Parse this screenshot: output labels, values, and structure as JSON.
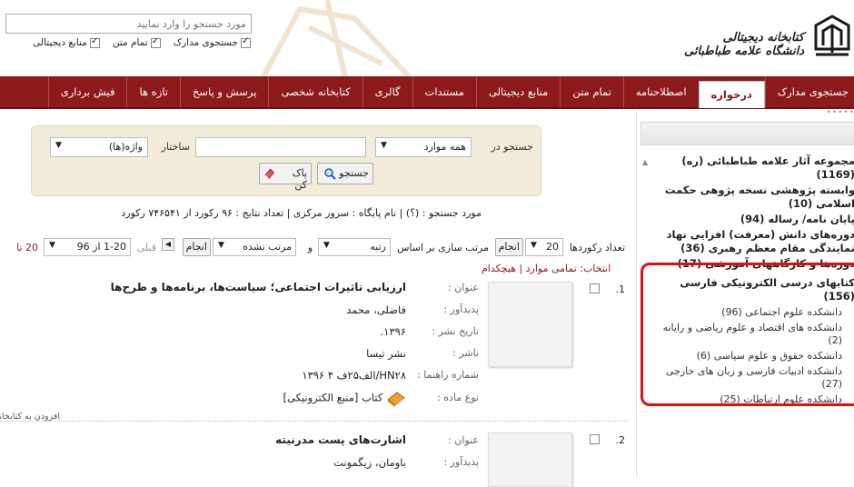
{
  "header": {
    "search_placeholder": "مورد جستجو را وارد نمایید",
    "checkboxes": [
      {
        "label": "جستجوی مدارک",
        "checked": true
      },
      {
        "label": "تمام متن",
        "checked": true
      },
      {
        "label": "منابع دیجیتالی",
        "checked": true
      }
    ],
    "logo_text": "کتابخانه دیجیتالی دانشگاه علامه طباطبائی"
  },
  "nav": {
    "items": [
      "جستجوی مدارک",
      "درخواره",
      "اصطلاحنامه",
      "تمام متن",
      "منابع دیجیتالی",
      "مستندات",
      "گالری",
      "کتابخانه شخصی",
      "پرسش و پاسخ",
      "تازه ها",
      "فیش برداری"
    ],
    "active_index": 1
  },
  "search_panel": {
    "search_in_label": "جستجو در",
    "search_in_value": "همه موارد",
    "structure_label": "ساختار",
    "structure_value": "واژه(ها)",
    "search_button": "جستجو",
    "clear_button": "پاک کن"
  },
  "query_info": "مورد جستجو : (؟) | نام پایگاه : سرور مرکزی | تعداد نتایج : ۹۶ رکورد از ۷۴۶۵۴۱ رکورد",
  "results_bar": {
    "records_count_label": "تعداد رکوردها",
    "records_count_value": "20",
    "do_button": "انجام",
    "sort_label": "مرتب سازی بر اساس",
    "sort_field": "رتبه",
    "and_label": "و",
    "sort_order": "مرتب نشده",
    "prev_label": "قبلی",
    "page_range": "1-20 از 96",
    "next_text": "20 تا"
  },
  "select_row": "انتخاب: تمامی موارد | هیچکدام",
  "records": [
    {
      "number": "1.",
      "fields": [
        {
          "label": "عنوان :",
          "value": "ارزیابی تاثیرات اجتماعی؛ سیاست‌ها، برنامه‌ها و طرح‌ها"
        },
        {
          "label": "پدیدآور :",
          "value": "فاضلی، محمد"
        },
        {
          "label": "تاریخ نشر :",
          "value": "۱۳۹۶."
        },
        {
          "label": "ناشر :",
          "value": "نشر تیسا"
        },
        {
          "label": "شماره راهنما :",
          "value": "HN۲۸/الف۲۵ف ۴ ۱۳۹۶"
        },
        {
          "label": "نوع ماده :",
          "value": "کتاب [منبع الکترونیکی]"
        }
      ],
      "add_to_cart": "افزودن به کتابخانه شخصی"
    },
    {
      "number": "2.",
      "fields": [
        {
          "label": "عنوان :",
          "value": "اشارت‌های پست مدرنیته"
        },
        {
          "label": "پدیدآور :",
          "value": "باومان، زیگمونت"
        }
      ]
    }
  ],
  "sidebar": {
    "facets": [
      {
        "label": "مجموعه آثار علامه طباطبائی (ره) (1169)"
      },
      {
        "label": "وابسته پژوهشی نسخه پژوهی حکمت اسلامی (10)"
      },
      {
        "label": "پایان نامه/ رساله (94)"
      },
      {
        "label": "دوره‌های دانش (معرفت) افزایی نهاد نمایندگی مقام معظم رهبری (36)"
      },
      {
        "label": "دوره‌ها و کارگاههای آموزشی (17)"
      },
      {
        "label": "کتابهای درسی الکترونیکی فارسی (156)"
      }
    ],
    "sub_facets": [
      "دانشکده علوم اجتماعی (96)",
      "دانشکده های اقتصاد و علوم ریاضی و رایانه (2)",
      "دانشکده حقوق و علوم سیاسی (6)",
      "دانشکده ادبیات فارسی و زبان های خارجی (27)",
      "دانشکده علوم ارتباطات (25)"
    ]
  },
  "colors": {
    "brand": "#8c1a1a",
    "highlight": "#e01010",
    "panel": "#f4ecdb"
  }
}
